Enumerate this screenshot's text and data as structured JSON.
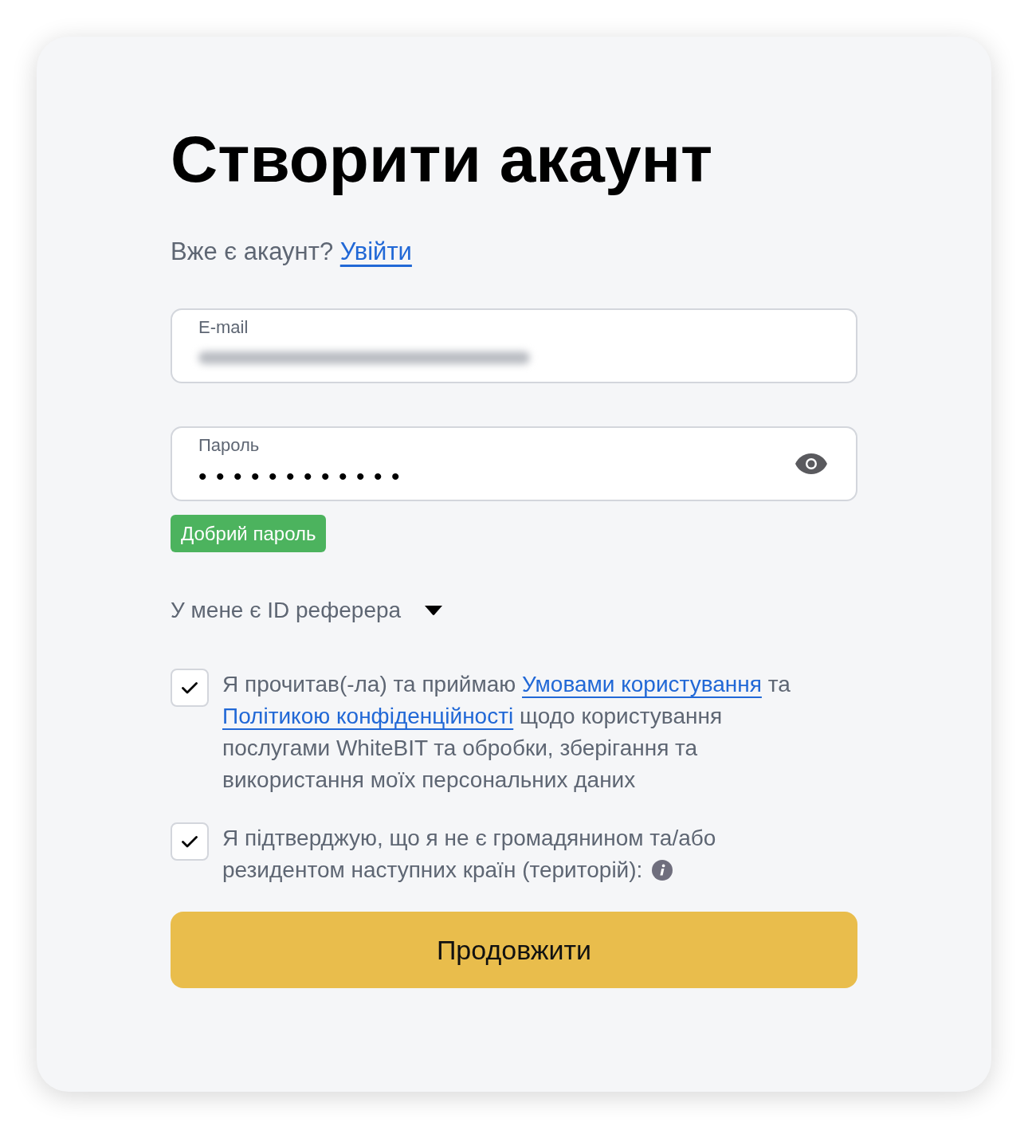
{
  "title": "Створити акаунт",
  "signin_prompt": {
    "text": "Вже є акаунт?",
    "link": "Увійти"
  },
  "fields": [
    {
      "kind": "email",
      "label": "E-mail",
      "value_blurred": true
    },
    {
      "kind": "password",
      "label": "Пароль",
      "value": "••••••••••••",
      "strength": "Добрий пароль"
    }
  ],
  "referrer_toggle": {
    "label": "У мене є ID реферера",
    "expanded": false
  },
  "agreements": [
    {
      "checked": true,
      "info_icon": false,
      "parts": [
        {
          "kind": "text",
          "text": "Я прочитав(-ла) та приймаю "
        },
        {
          "kind": "link",
          "text": "Умовами користування"
        },
        {
          "kind": "text",
          "text": " та "
        },
        {
          "kind": "link",
          "text": "Політикою конфіденційності"
        },
        {
          "kind": "text",
          "text": " щодо користування послугами WhiteBIT та обробки, зберігання та використання моїх персональних даних"
        }
      ]
    },
    {
      "checked": true,
      "info_icon": true,
      "parts": [
        {
          "kind": "text",
          "text": "Я підтверджую, що я не є громадянином та/або резидентом наступних країн (територій):"
        }
      ]
    }
  ],
  "submit_button": "Продовжити"
}
